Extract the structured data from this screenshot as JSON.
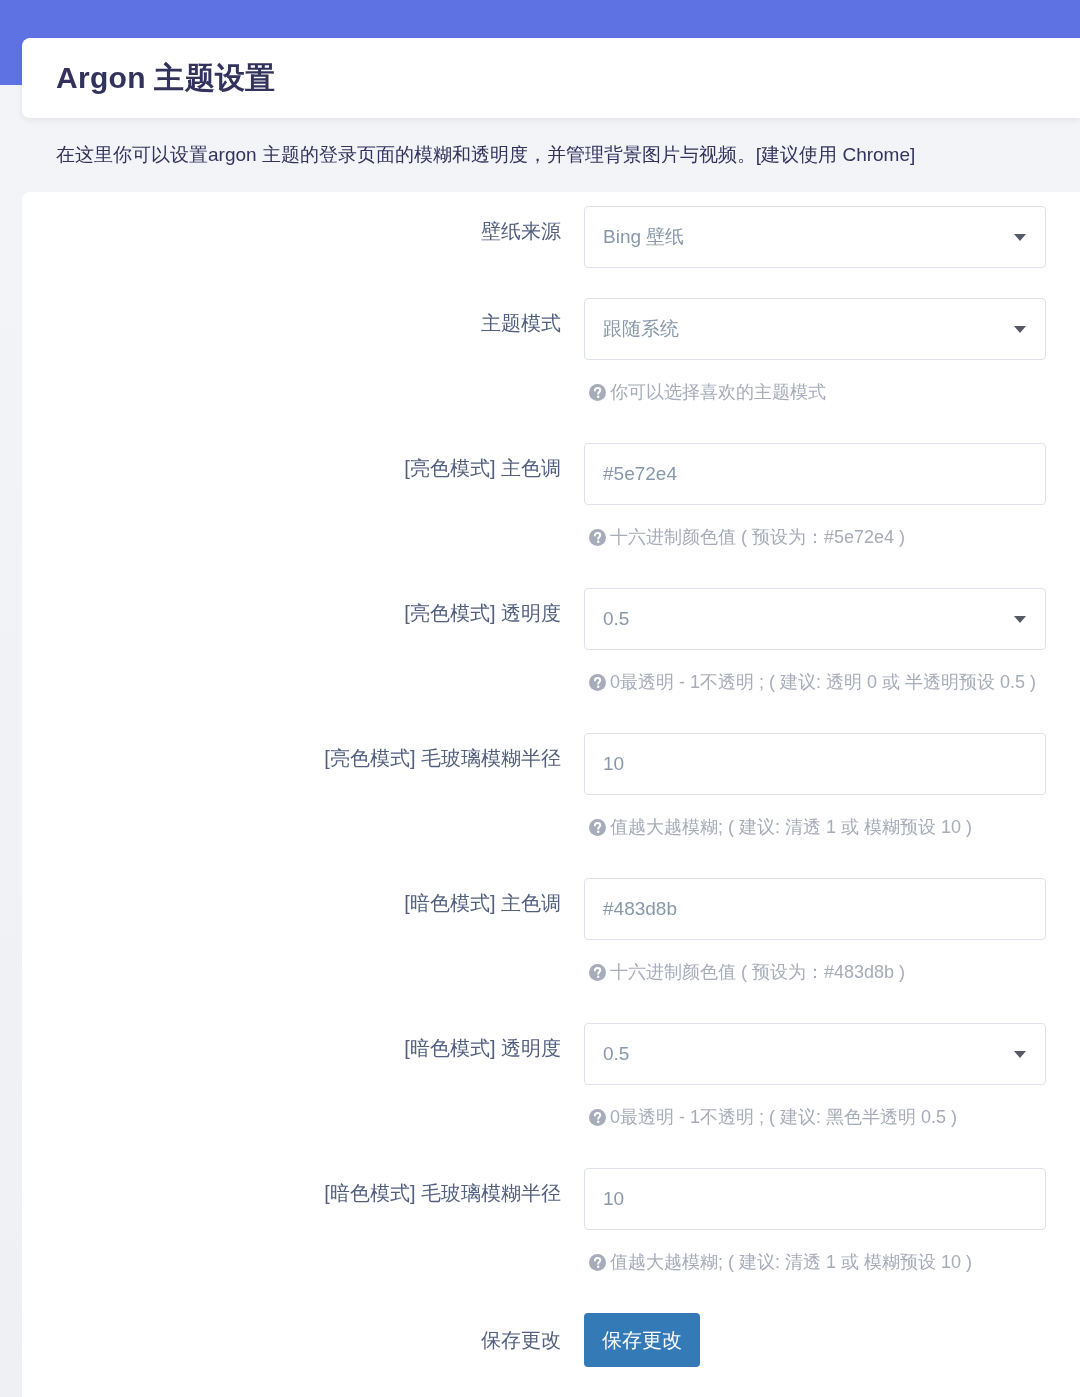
{
  "header": {
    "title": "Argon 主题设置"
  },
  "description": "在这里你可以设置argon 主题的登录页面的模糊和透明度，并管理背景图片与视频。[建议使用 Chrome]",
  "form": {
    "fields": [
      {
        "label": "壁纸来源",
        "kind": "select",
        "value": "Bing 壁纸"
      },
      {
        "label": "主题模式",
        "kind": "select",
        "value": "跟随系统",
        "hint": "你可以选择喜欢的主题模式"
      },
      {
        "label": "[亮色模式] 主色调",
        "kind": "text",
        "value": "#5e72e4",
        "hint": "十六进制颜色值 ( 预设为：#5e72e4 )"
      },
      {
        "label": "[亮色模式] 透明度",
        "kind": "select",
        "value": "0.5",
        "hint": "0最透明 - 1不透明 ; ( 建议: 透明 0 或 半透明预设 0.5 )"
      },
      {
        "label": "[亮色模式] 毛玻璃模糊半径",
        "kind": "text",
        "value": "10",
        "hint": "值越大越模糊; ( 建议: 清透 1 或 模糊预设 10 )"
      },
      {
        "label": "[暗色模式] 主色调",
        "kind": "text",
        "value": "#483d8b",
        "hint": "十六进制颜色值 ( 预设为：#483d8b )"
      },
      {
        "label": "[暗色模式] 透明度",
        "kind": "select",
        "value": "0.5",
        "hint": "0最透明 - 1不透明 ; ( 建议: 黑色半透明 0.5 )"
      },
      {
        "label": "[暗色模式] 毛玻璃模糊半径",
        "kind": "text",
        "value": "10",
        "hint": "值越大越模糊; ( 建议: 清透 1 或 模糊预设 10 )"
      }
    ],
    "save": {
      "label": "保存更改",
      "button": "保存更改"
    }
  }
}
